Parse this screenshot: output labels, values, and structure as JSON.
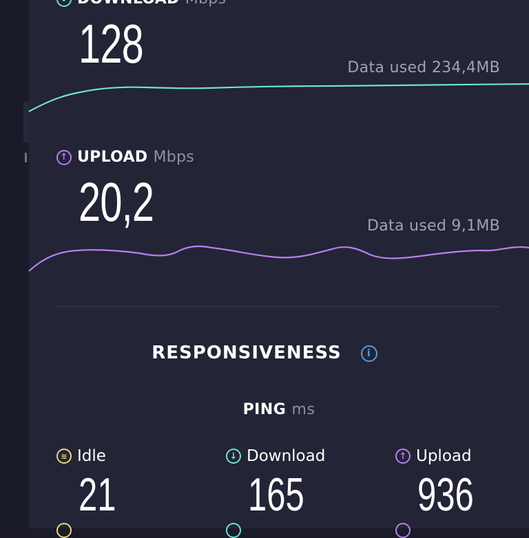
{
  "download": {
    "label": "DOWNLOAD",
    "unit": "Mbps",
    "value": "128",
    "data_used": "Data used 234,4MB",
    "color": "#6ee3d3"
  },
  "upload": {
    "label": "UPLOAD",
    "unit": "Mbps",
    "value": "20,2",
    "data_used": "Data used 9,1MB",
    "color": "#b980ef"
  },
  "responsiveness": {
    "title": "RESPONSIVENESS",
    "info_icon": "ⓘ"
  },
  "ping": {
    "label": "PING",
    "unit": "ms",
    "columns": [
      {
        "name": "idle",
        "label": "Idle",
        "value": "21",
        "icon": "idle-icon",
        "color": "#ebd97a"
      },
      {
        "name": "download",
        "label": "Download",
        "value": "165",
        "icon": "download-icon",
        "color": "#6ee3d3"
      },
      {
        "name": "upload",
        "label": "Upload",
        "value": "936",
        "icon": "upload-icon",
        "color": "#b980ef"
      }
    ]
  }
}
